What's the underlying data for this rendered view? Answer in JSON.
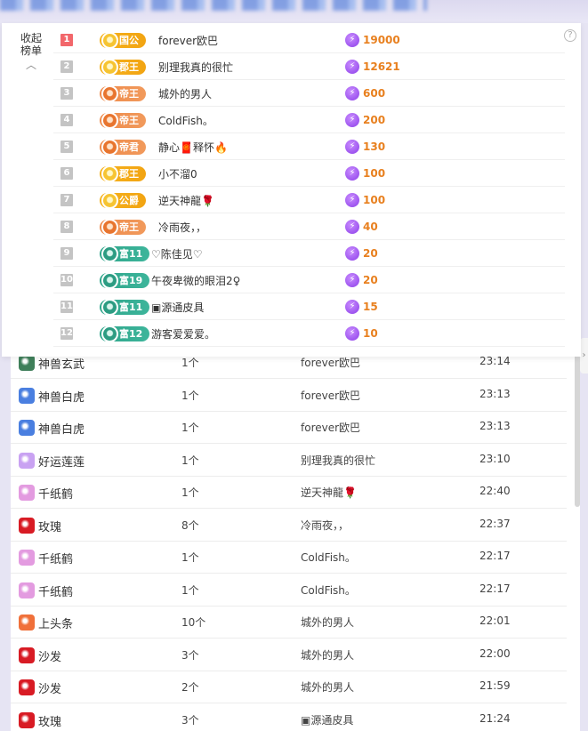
{
  "rank": {
    "collapse_label": "收起榜单",
    "help_label": "?",
    "rows": [
      {
        "rank": "1",
        "badge_type": "gold",
        "badge": "国公",
        "name": "forever欧巴",
        "score": "19000"
      },
      {
        "rank": "2",
        "badge_type": "gold",
        "badge": "郡王",
        "name": "别理我真的很忙",
        "score": "12621"
      },
      {
        "rank": "3",
        "badge_type": "orange",
        "badge": "帝王",
        "name": "城外的男人",
        "score": "600"
      },
      {
        "rank": "4",
        "badge_type": "orange",
        "badge": "帝王",
        "name": "ColdFish。",
        "score": "200"
      },
      {
        "rank": "5",
        "badge_type": "orange",
        "badge": "帝君",
        "name": "静心🧧释怀🔥",
        "score": "130"
      },
      {
        "rank": "6",
        "badge_type": "gold",
        "badge": "郡王",
        "name": "小不溜0",
        "score": "100"
      },
      {
        "rank": "7",
        "badge_type": "gold",
        "badge": "公爵",
        "name": "逆天神龍🌹",
        "score": "100"
      },
      {
        "rank": "8",
        "badge_type": "orange",
        "badge": "帝王",
        "name": "冷雨夜，，",
        "score": "40"
      },
      {
        "rank": "9",
        "badge_type": "green",
        "badge": "富11",
        "name": "♡陈佳见♡",
        "score": "20"
      },
      {
        "rank": "10",
        "badge_type": "green",
        "badge": "富19",
        "name": "午夜卑微的眼泪2♀",
        "score": "20"
      },
      {
        "rank": "11",
        "badge_type": "green",
        "badge": "富11",
        "name": "▣源通皮具",
        "score": "15"
      },
      {
        "rank": "12",
        "badge_type": "green",
        "badge": "富12",
        "name": "游客爱爱爱。",
        "score": "10"
      }
    ]
  },
  "gifts": [
    {
      "icon": "dragon-turtle-icon",
      "icon_color": "#3f7f5a",
      "name": "神兽玄武",
      "count": "1个",
      "user": "forever欧巴",
      "time": "23:14"
    },
    {
      "icon": "white-tiger-icon",
      "icon_color": "#4a7fe0",
      "name": "神兽白虎",
      "count": "1个",
      "user": "forever欧巴",
      "time": "23:13"
    },
    {
      "icon": "white-tiger-icon",
      "icon_color": "#4a7fe0",
      "name": "神兽白虎",
      "count": "1个",
      "user": "forever欧巴",
      "time": "23:13"
    },
    {
      "icon": "lotus-icon",
      "icon_color": "#c9a2f2",
      "name": "好运莲莲",
      "count": "1个",
      "user": "别理我真的很忙",
      "time": "23:10"
    },
    {
      "icon": "paper-crane-icon",
      "icon_color": "#e39be0",
      "name": "千纸鹤",
      "count": "1个",
      "user": "逆天神龍🌹",
      "time": "22:40"
    },
    {
      "icon": "rose-icon",
      "icon_color": "#d81b24",
      "name": "玫瑰",
      "count": "8个",
      "user": "冷雨夜，，",
      "time": "22:37"
    },
    {
      "icon": "paper-crane-icon",
      "icon_color": "#e39be0",
      "name": "千纸鹤",
      "count": "1个",
      "user": "ColdFish。",
      "time": "22:17"
    },
    {
      "icon": "paper-crane-icon",
      "icon_color": "#e39be0",
      "name": "千纸鹤",
      "count": "1个",
      "user": "ColdFish。",
      "time": "22:17"
    },
    {
      "icon": "headline-icon",
      "icon_color": "#f0703a",
      "name": "上头条",
      "count": "10个",
      "user": "城外的男人",
      "time": "22:01"
    },
    {
      "icon": "sofa-icon",
      "icon_color": "#d81b24",
      "name": "沙发",
      "count": "3个",
      "user": "城外的男人",
      "time": "22:00"
    },
    {
      "icon": "sofa-icon",
      "icon_color": "#d81b24",
      "name": "沙发",
      "count": "2个",
      "user": "城外的男人",
      "time": "21:59"
    },
    {
      "icon": "rose-icon",
      "icon_color": "#d81b24",
      "name": "玫瑰",
      "count": "3个",
      "user": "▣源通皮具",
      "time": "21:24"
    }
  ],
  "side_tab": "›"
}
